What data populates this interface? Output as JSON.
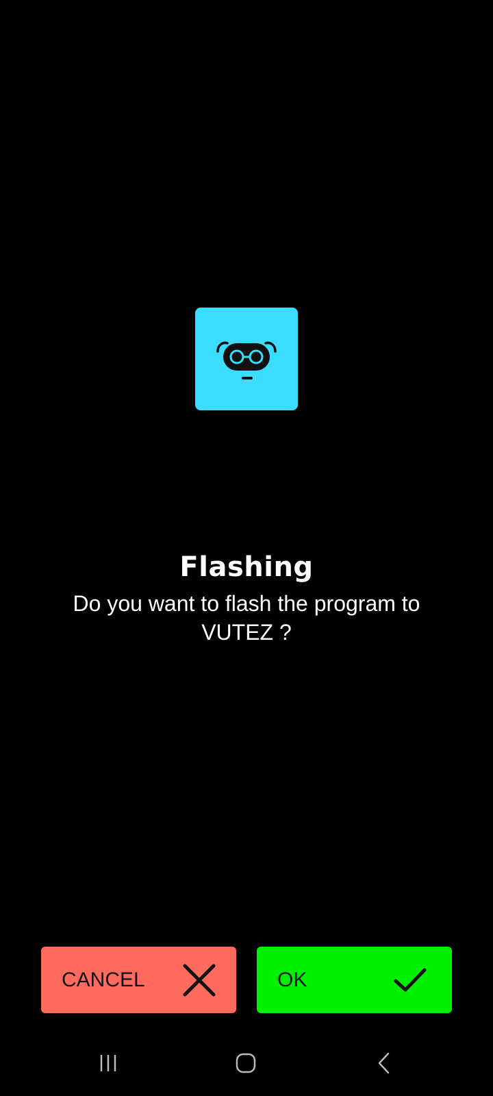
{
  "app": {
    "accent_color": "#3cdcfe",
    "icon": "robot-face-icon"
  },
  "dialog": {
    "title": "Flashing",
    "message": "Do you want to flash the program to VUTEZ ?"
  },
  "buttons": {
    "cancel": {
      "label": "CANCEL",
      "icon": "close-icon",
      "color": "#ff6a5f"
    },
    "ok": {
      "label": "OK",
      "icon": "checkmark-icon",
      "color": "#00f000"
    }
  },
  "navigation_bar": {
    "recent_apps_icon": "recent-apps-icon",
    "home_icon": "home-icon",
    "back_icon": "back-icon"
  }
}
